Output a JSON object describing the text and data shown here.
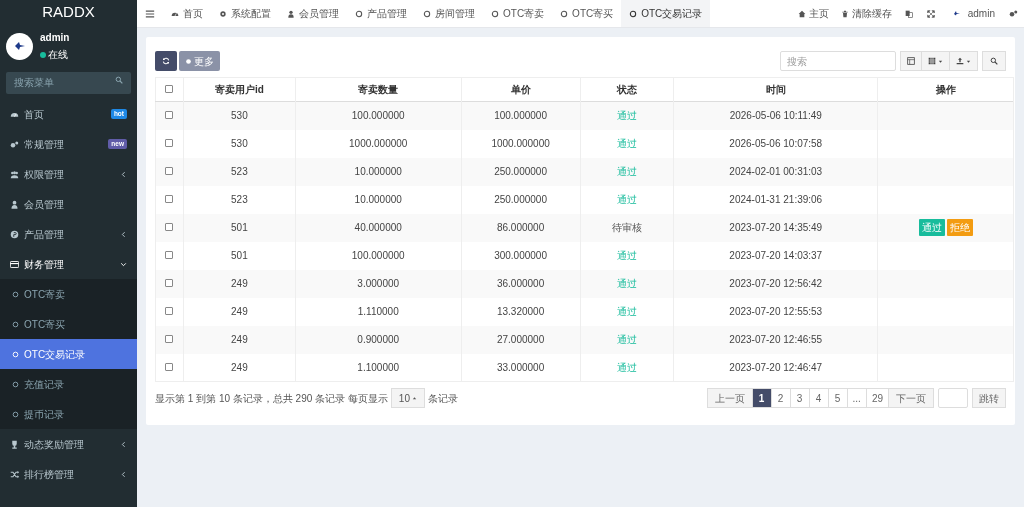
{
  "sidebar": {
    "brand": "RADDX",
    "user": {
      "name": "admin",
      "status": "在线",
      "online": true
    },
    "search_placeholder": "搜索菜单",
    "menu": [
      {
        "label": "首页",
        "kind": "link",
        "expanded": false,
        "badge": {
          "text": "hot",
          "color": "#1e88e5"
        }
      },
      {
        "label": "常规管理",
        "kind": "link",
        "expanded": false,
        "badge": {
          "text": "new",
          "color": "#605ca8"
        }
      },
      {
        "label": "权限管理",
        "kind": "group",
        "expanded": false
      },
      {
        "label": "会员管理",
        "kind": "link",
        "expanded": false
      },
      {
        "label": "产品管理",
        "kind": "group",
        "expanded": false
      },
      {
        "label": "财务管理",
        "kind": "group",
        "expanded": true,
        "children": [
          {
            "label": "OTC寄卖",
            "selected": false
          },
          {
            "label": "OTC寄买",
            "selected": false
          },
          {
            "label": "OTC交易记录",
            "selected": true
          },
          {
            "label": "充值记录",
            "selected": false
          },
          {
            "label": "提币记录",
            "selected": false
          }
        ]
      },
      {
        "label": "动态奖励管理",
        "kind": "group",
        "expanded": false
      },
      {
        "label": "排行榜管理",
        "kind": "group",
        "expanded": false
      }
    ]
  },
  "top_tabs": [
    {
      "label": "首页",
      "selected": false
    },
    {
      "label": "系统配置",
      "selected": false
    },
    {
      "label": "会员管理",
      "selected": false
    },
    {
      "label": "产品管理",
      "selected": false
    },
    {
      "label": "房间管理",
      "selected": false
    },
    {
      "label": "OTC寄卖",
      "selected": false
    },
    {
      "label": "OTC寄买",
      "selected": false
    },
    {
      "label": "OTC交易记录",
      "selected": true
    }
  ],
  "top_right": {
    "home": "主页",
    "clear_cache": "清除缓存",
    "user": "admin"
  },
  "toolbar": {
    "more": "更多",
    "search_placeholder": "搜索"
  },
  "table": {
    "all_checked": false,
    "columns": [
      "寄卖用户id",
      "寄卖数量",
      "单价",
      "状态",
      "时间",
      "操作"
    ],
    "rows": [
      {
        "checked": false,
        "user_id": "530",
        "quantity": "100.000000",
        "price": "100.000000",
        "status": "通过",
        "kind": "approved",
        "time": "2026-05-06 10:11:49"
      },
      {
        "checked": false,
        "user_id": "530",
        "quantity": "1000.000000",
        "price": "1000.000000",
        "status": "通过",
        "kind": "approved",
        "time": "2026-05-06 10:07:58"
      },
      {
        "checked": false,
        "user_id": "523",
        "quantity": "10.000000",
        "price": "250.000000",
        "status": "通过",
        "kind": "approved",
        "time": "2024-02-01 00:31:03"
      },
      {
        "checked": false,
        "user_id": "523",
        "quantity": "10.000000",
        "price": "250.000000",
        "status": "通过",
        "kind": "approved",
        "time": "2024-01-31 21:39:06"
      },
      {
        "checked": false,
        "user_id": "501",
        "quantity": "40.000000",
        "price": "86.000000",
        "status": "待审核",
        "kind": "pending",
        "time": "2023-07-20 14:35:49",
        "actions": [
          "通过",
          "拒绝"
        ]
      },
      {
        "checked": false,
        "user_id": "501",
        "quantity": "100.000000",
        "price": "300.000000",
        "status": "通过",
        "kind": "approved",
        "time": "2023-07-20 14:03:37"
      },
      {
        "checked": false,
        "user_id": "249",
        "quantity": "3.000000",
        "price": "36.000000",
        "status": "通过",
        "kind": "approved",
        "time": "2023-07-20 12:56:42"
      },
      {
        "checked": false,
        "user_id": "249",
        "quantity": "1.110000",
        "price": "13.320000",
        "status": "通过",
        "kind": "approved",
        "time": "2023-07-20 12:55:53"
      },
      {
        "checked": false,
        "user_id": "249",
        "quantity": "0.900000",
        "price": "27.000000",
        "status": "通过",
        "kind": "approved",
        "time": "2023-07-20 12:46:55"
      },
      {
        "checked": false,
        "user_id": "249",
        "quantity": "1.100000",
        "price": "33.000000",
        "status": "通过",
        "kind": "approved",
        "time": "2023-07-20 12:46:47"
      }
    ]
  },
  "footer": {
    "summary": "显示第 1 到第 10 条记录，总共 290 条记录 每页显示",
    "page_size": "10",
    "suffix": "条记录"
  },
  "pagination": {
    "prev": "上一页",
    "pages": [
      {
        "label": "1",
        "selected": true
      },
      {
        "label": "2",
        "selected": false
      },
      {
        "label": "3",
        "selected": false
      },
      {
        "label": "4",
        "selected": false
      },
      {
        "label": "5",
        "selected": false
      },
      {
        "label": "...",
        "selected": false
      },
      {
        "label": "29",
        "selected": false
      }
    ],
    "next": "下一页",
    "jump": "跳转"
  }
}
